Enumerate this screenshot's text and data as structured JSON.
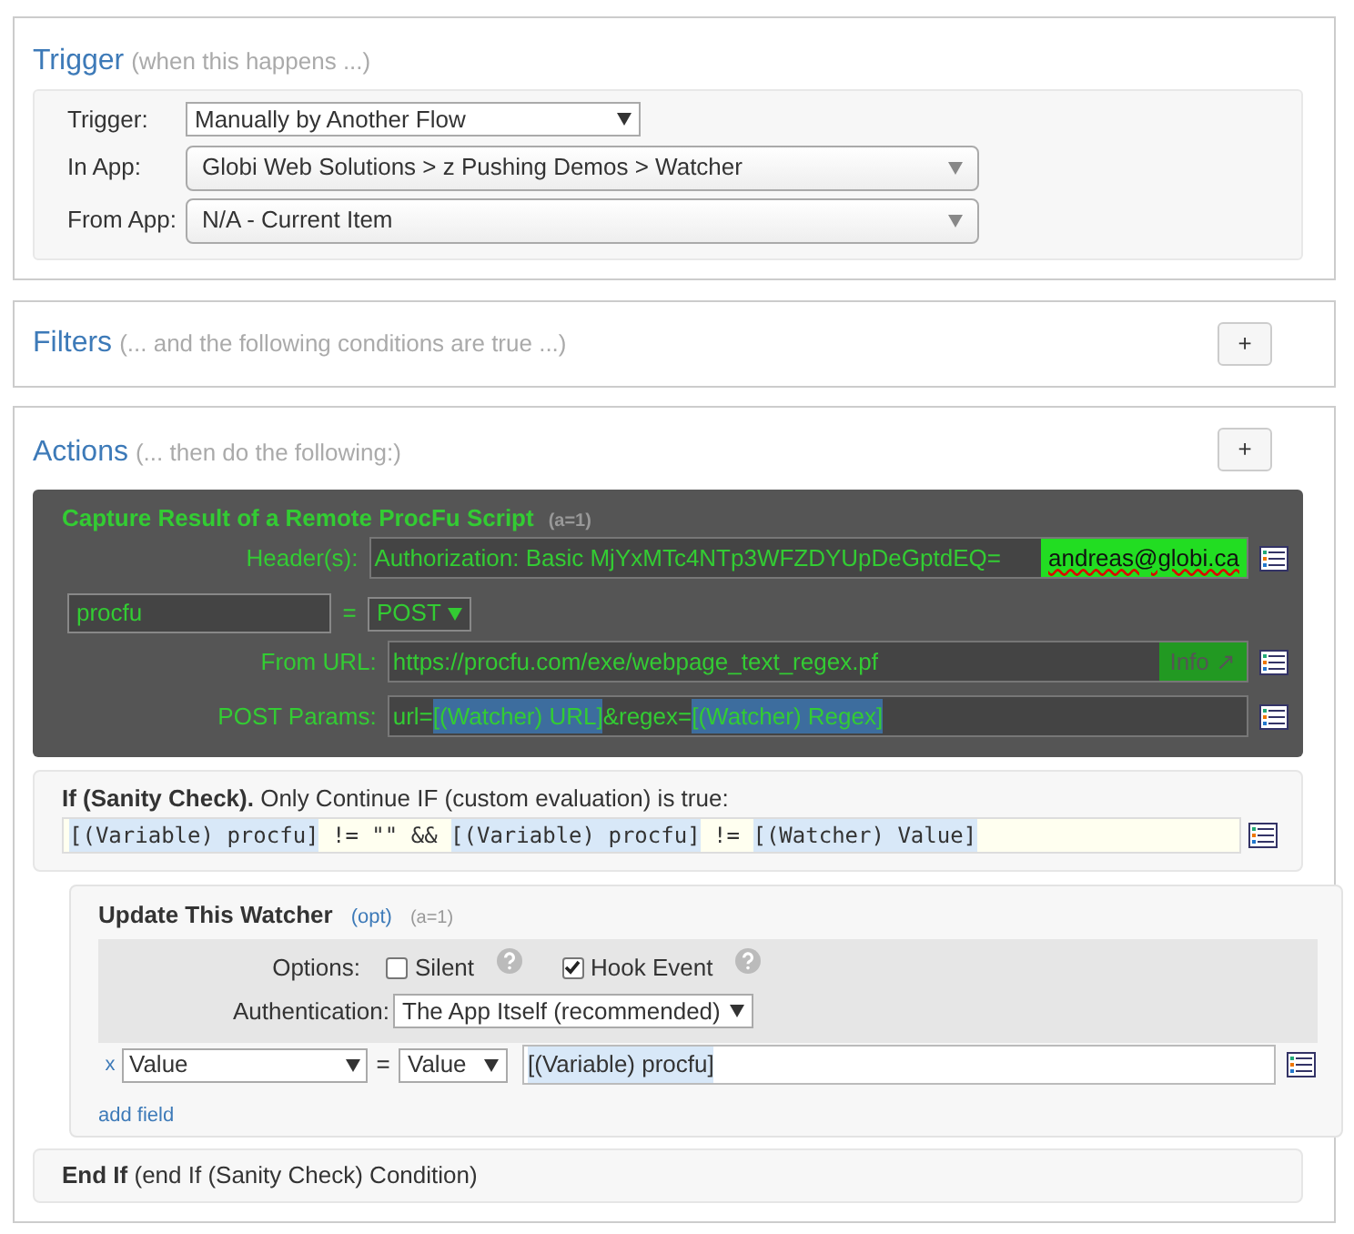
{
  "trigger": {
    "title": "Trigger",
    "hint": "(when this happens ...)",
    "rows": [
      {
        "label": "Trigger:",
        "value": "Manually by Another Flow",
        "kind": "plain"
      },
      {
        "label": "In App:",
        "value": "Globi Web Solutions > z Pushing Demos > Watcher",
        "kind": "rounded"
      },
      {
        "label": "From App:",
        "value": "N/A - Current Item",
        "kind": "rounded"
      }
    ]
  },
  "filters": {
    "title": "Filters",
    "hint": "(... and the following conditions are true ...)",
    "add_button": "+"
  },
  "actions": {
    "title": "Actions",
    "hint": "(... then do the following:)",
    "add_button": "+",
    "capture": {
      "title": "Capture Result of a Remote ProcFu Script",
      "count": "(a=1)",
      "headers_label": "Header(s):",
      "headers_value": "Authorization: Basic MjYxMTc4NTp3WFZDYUpDeGptdEQ=",
      "headers_user": "andreas@globi.ca",
      "variable": "procfu",
      "equals": "=",
      "method": "POST",
      "url_label": "From URL:",
      "url": "https://procfu.com/exe/webpage_text_regex.pf",
      "info_button": "Info ↗",
      "params_label": "POST Params:",
      "params": [
        {
          "kind": "text",
          "text": "url="
        },
        {
          "kind": "token",
          "text": "[(Watcher) URL]"
        },
        {
          "kind": "text",
          "text": "&regex="
        },
        {
          "kind": "token",
          "text": "[(Watcher) Regex]"
        }
      ]
    },
    "condition": {
      "title": "If (Sanity Check).",
      "text": "Only Continue IF (custom evaluation) is true:",
      "code": [
        {
          "kind": "token",
          "text": "[(Variable) procfu]"
        },
        {
          "kind": "text",
          "text": " != \"\" && "
        },
        {
          "kind": "token",
          "text": "[(Variable) procfu]"
        },
        {
          "kind": "text",
          "text": " != "
        },
        {
          "kind": "token",
          "text": "[(Watcher) Value]"
        }
      ]
    },
    "update": {
      "title": "Update This Watcher",
      "opt": "(opt)",
      "count": "(a=1)",
      "options_label": "Options:",
      "options": [
        {
          "label": "Silent",
          "checked": false
        },
        {
          "label": "Hook Event",
          "checked": true
        }
      ],
      "auth_label": "Authentication:",
      "auth_value": "The App Itself (recommended)",
      "remove": "x",
      "field": "Value",
      "equals": "=",
      "field_mode": "Value",
      "field_value": [
        {
          "kind": "token",
          "text": "[(Variable) procfu]"
        }
      ],
      "add_field": "add field"
    },
    "end_if": {
      "title": "End If",
      "text": "(end If (Sanity Check) Condition)"
    }
  }
}
